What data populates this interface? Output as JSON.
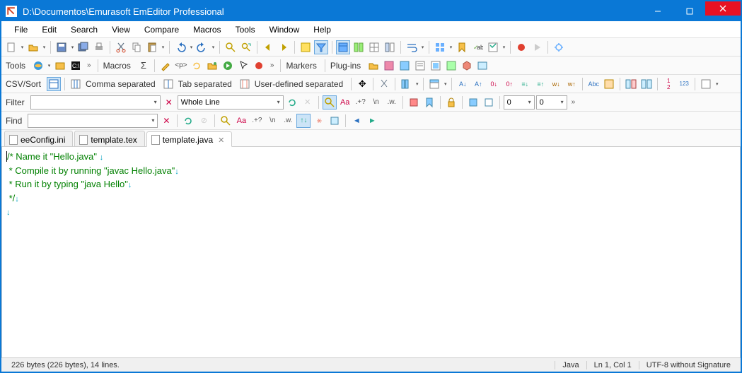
{
  "title": "D:\\Documentos\\Emurasoft EmEditor Professional",
  "menu": [
    "File",
    "Edit",
    "Search",
    "View",
    "Compare",
    "Macros",
    "Tools",
    "Window",
    "Help"
  ],
  "row2": {
    "tools": "Tools",
    "macros": "Macros",
    "markers": "Markers",
    "plugins": "Plug-ins"
  },
  "row3": {
    "csvsort": "CSV/Sort",
    "comma": "Comma separated",
    "tab": "Tab separated",
    "user": "User-defined separated"
  },
  "row4": {
    "filter": "Filter",
    "scope": "Whole Line",
    "num1": "0",
    "num2": "0"
  },
  "row5": {
    "find": "Find"
  },
  "tabs": [
    {
      "label": "eeConfig.ini",
      "active": false
    },
    {
      "label": "template.tex",
      "active": false
    },
    {
      "label": "template.java",
      "active": true
    }
  ],
  "code": {
    "l1": "/* Name it \"Hello.java\" ",
    "l2": " * Compile it by running \"javac Hello.java\"",
    "l3": " * Run it by typing \"java Hello\"",
    "l4": " */"
  },
  "status": {
    "left": "226 bytes (226 bytes), 14 lines.",
    "lang": "Java",
    "pos": "Ln 1, Col 1",
    "enc": "UTF-8 without Signature"
  }
}
